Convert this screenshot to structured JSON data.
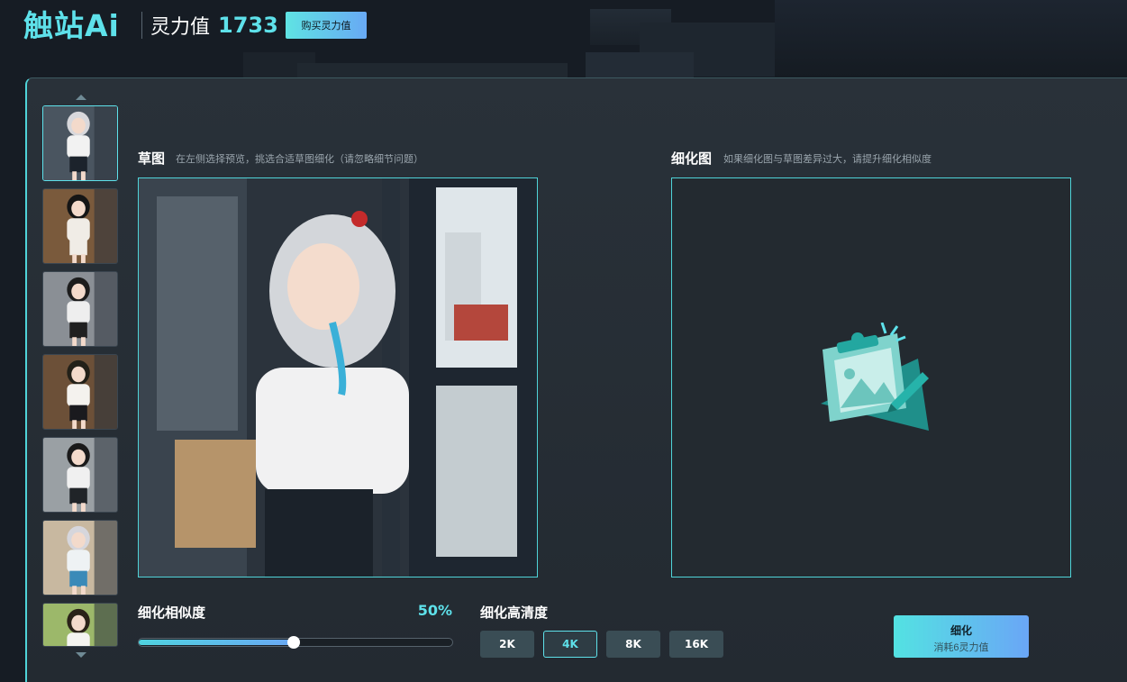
{
  "header": {
    "logo": "触站Ai",
    "points_label": "灵力值",
    "points_value": "1733",
    "buy_button": "购买灵力值"
  },
  "sketch": {
    "title": "草图",
    "hint": "在左侧选择预览，挑选合适草图细化（请忽略细节问题）"
  },
  "refine": {
    "title": "细化图",
    "hint": "如果细化图与草图差异过大，请提升细化相似度",
    "placeholder_icon": "image-edit-icon"
  },
  "similarity": {
    "label": "细化相似度",
    "value": "50%",
    "level": 0.5
  },
  "resolution": {
    "label": "细化高清度",
    "options": [
      "2K",
      "4K",
      "8K",
      "16K"
    ],
    "selected": "4K"
  },
  "action": {
    "label": "细化",
    "cost": "消耗6灵力值"
  },
  "colors": {
    "accent": "#5ee1ea",
    "background": "#161c24",
    "panel": "#262e35"
  },
  "thumbnails": [
    {
      "hair": "#d8d8dc",
      "top": "#f2f2f2",
      "bottom": "#1c232c",
      "bg": "#4a5560"
    },
    {
      "hair": "#151515",
      "top": "#f0ece6",
      "bottom": "#f0ece6",
      "bg": "#7a5a3c"
    },
    {
      "hair": "#1c1c1c",
      "top": "#eeeeee",
      "bottom": "#202020",
      "bg": "#8a8f95"
    },
    {
      "hair": "#222018",
      "top": "#f4f2ee",
      "bottom": "#1a1a1e",
      "bg": "#6c5038"
    },
    {
      "hair": "#1a1a1a",
      "top": "#f0f0f0",
      "bottom": "#202428",
      "bg": "#9aa0a4"
    },
    {
      "hair": "#d6d6dc",
      "top": "#eef2f4",
      "bottom": "#3a8ab8",
      "bg": "#c8b8a0"
    },
    {
      "hair": "#2a2218",
      "top": "#f4f4f0",
      "bottom": "#4a4e52",
      "bg": "#9cb86a"
    }
  ]
}
